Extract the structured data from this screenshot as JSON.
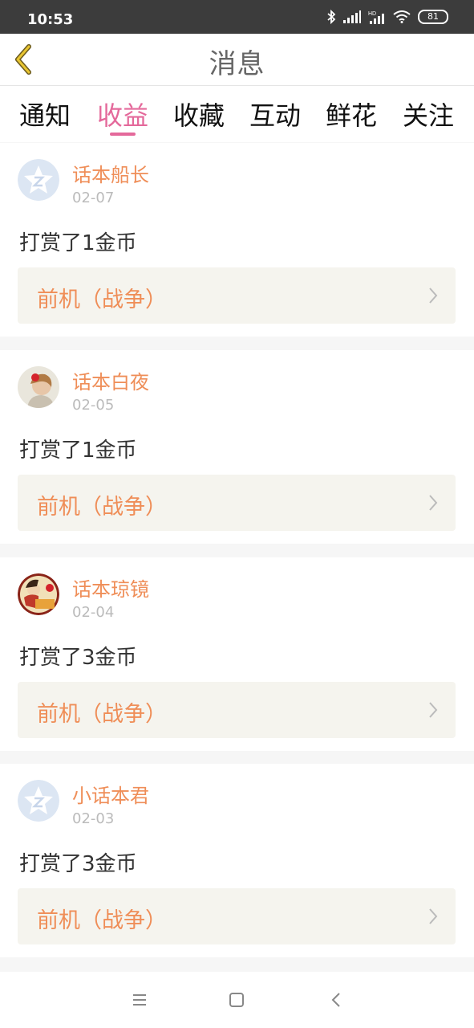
{
  "status_bar": {
    "time": "10:53",
    "battery": "81",
    "icons": [
      "bluetooth-icon",
      "signal-icon",
      "signal-hd-icon",
      "wifi-icon",
      "battery-icon"
    ]
  },
  "header": {
    "title": "消息",
    "back_icon": "chevron-left-icon"
  },
  "tabs": [
    {
      "label": "通知",
      "active": false
    },
    {
      "label": "收益",
      "active": true
    },
    {
      "label": "收藏",
      "active": false
    },
    {
      "label": "互动",
      "active": false
    },
    {
      "label": "鲜花",
      "active": false
    },
    {
      "label": "关注",
      "active": false
    }
  ],
  "messages": [
    {
      "user": "话本船长",
      "date": "02-07",
      "text": "打赏了1金币",
      "work": "前机（战争）",
      "avatar": "default-avatar"
    },
    {
      "user": "话本白夜",
      "date": "02-05",
      "text": "打赏了1金币",
      "work": "前机（战争）",
      "avatar": "photo-avatar"
    },
    {
      "user": "话本琼镜",
      "date": "02-04",
      "text": "打赏了3金币",
      "work": "前机（战争）",
      "avatar": "badge-avatar"
    },
    {
      "user": "小话本君",
      "date": "02-03",
      "text": "打赏了3金币",
      "work": "前机（战争）",
      "avatar": "default-avatar"
    }
  ],
  "colors": {
    "accent": "#e4699b",
    "username": "#ef8e58",
    "work_bg": "#f5f4ee"
  },
  "nav_bar": {
    "icons": [
      "menu-icon",
      "home-square-icon",
      "back-triangle-icon"
    ]
  }
}
